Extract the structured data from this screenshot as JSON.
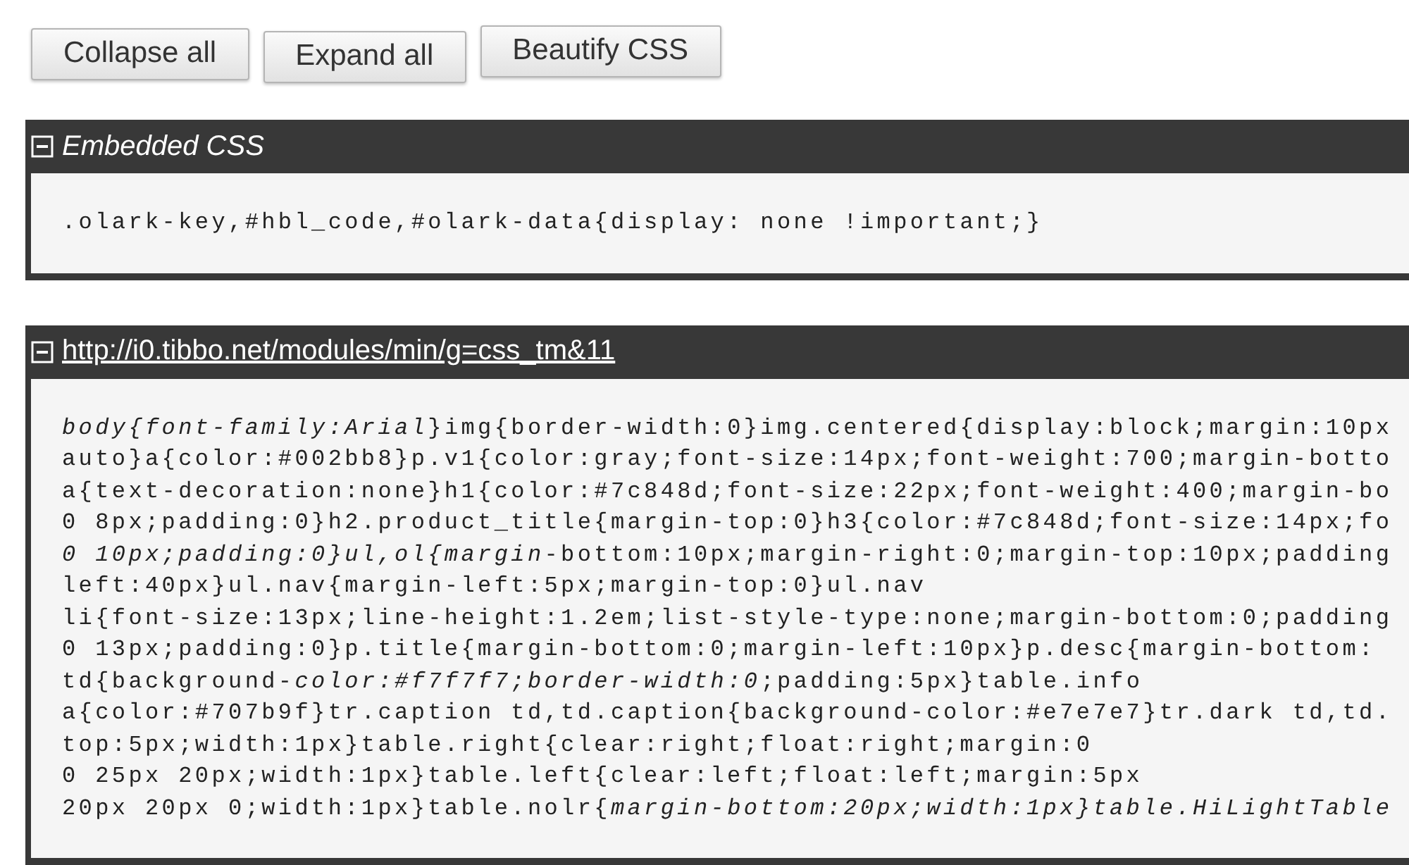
{
  "toolbar": {
    "buttons": [
      "Collapse all",
      "Expand all",
      "Beautify CSS"
    ]
  },
  "panels": [
    {
      "kind": "label",
      "title": "Embedded CSS",
      "expanded": true,
      "lines": [
        ".olark-key,#hbl_code,#olark-data{display: none !important;}"
      ]
    },
    {
      "kind": "link",
      "title": "http://i0.tibbo.net/modules/min/g=css_tm&11",
      "expanded": true,
      "lines": [
        "*body{font-family:Arial*}img{border-width:0}img.centered{display:block;margin:10px",
        "auto}a{color:#002bb8}p.v1{color:gray;font-size:14px;font-weight:700;margin-botto",
        "a{text-decoration:none}h1{color:#7c848d;font-size:22px;font-weight:400;margin-bo",
        "0 8px;padding:0}h2.product_title{margin-top:0}h3{color:#7c848d;font-size:14px;fo",
        "*0 10px;padding:0}ul,ol{margin*-bottom:10px;margin-right:0;margin-top:10px;padding",
        "left:40px}ul.nav{margin-left:5px;margin-top:0}ul.nav",
        "li{font-size:13px;line-height:1.2em;list-style-type:none;margin-bottom:0;padding",
        "0 13px;padding:0}p.title{margin-bottom:0;margin-left:10px}p.desc{margin-bottom:",
        "td{background-*color:#f7f7f7;border-width:0*;padding:5px}table.info",
        "a{color:#707b9f}tr.caption td,td.caption{background-color:#e7e7e7}tr.dark td,td.",
        "top:5px;width:1px}table.right{clear:right;float:right;margin:0",
        "0 25px 20px;width:1px}table.left{clear:left;float:left;margin:5px",
        "20px 20px 0;width:1px}table.nolr{*margin-bottom:20px;width:1px}table.HiLightTable*"
      ]
    }
  ]
}
